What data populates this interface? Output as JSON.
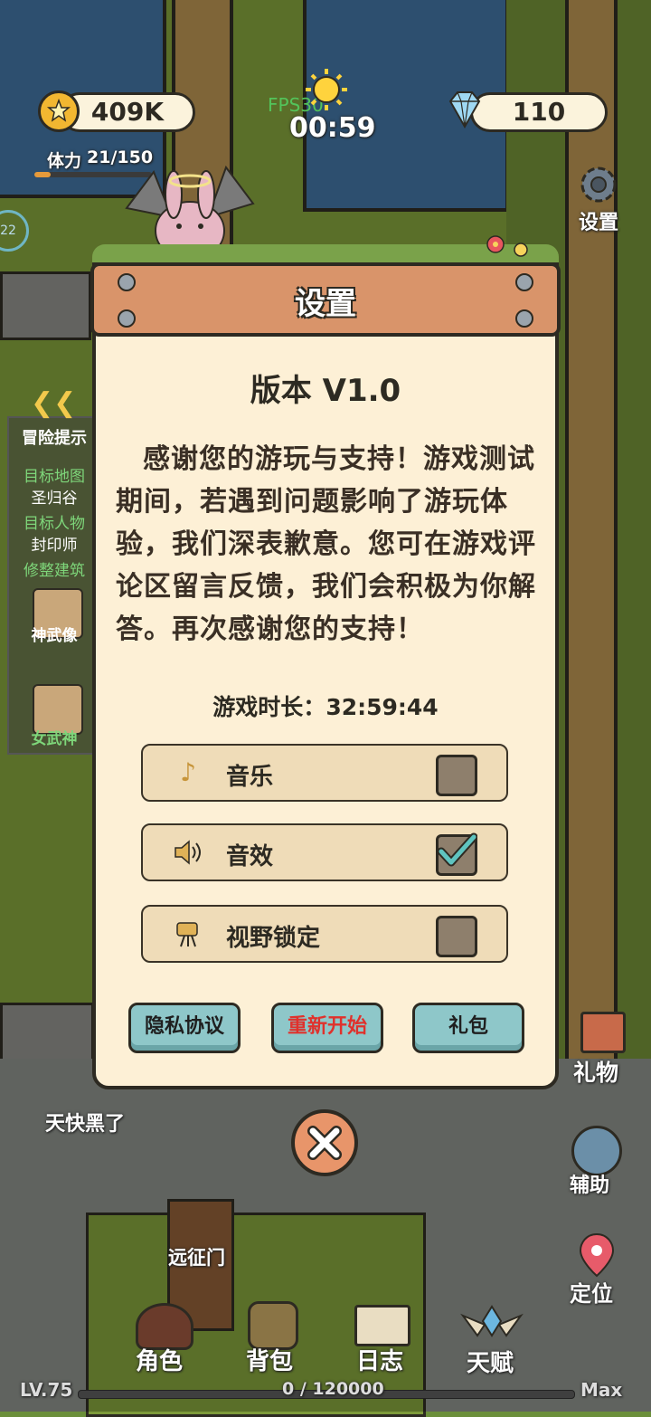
{
  "hud": {
    "coins": "409K",
    "gems": "110",
    "fps": "FPS30",
    "timer": "00:59",
    "stamina_label": "体力",
    "stamina_value": "21/150",
    "stamina_fraction": 0.14,
    "settings_label": "设置",
    "level_ring": "22"
  },
  "quest": {
    "header": "冒险提示",
    "target_map_label": "目标地图",
    "target_map_value": "圣归谷",
    "target_npc_label": "目标人物",
    "target_npc_value": "封印师",
    "task_label": "修整建筑",
    "statue1": "神武像",
    "statue2": "女武神"
  },
  "modal": {
    "title": "设置",
    "version": "版本 V1.0",
    "message": "感谢您的游玩与支持！游戏测试期间，若遇到问题影响了游玩体验，我们深表歉意。您可在游戏评论区留言反馈，我们会积极为你解答。再次感谢您的支持！",
    "playtime_label": "游戏时长：",
    "playtime_value": "32:59:44",
    "toggles": [
      {
        "label": "音乐",
        "icon": "music-note-icon",
        "checked": false
      },
      {
        "label": "音效",
        "icon": "speaker-icon",
        "checked": true
      },
      {
        "label": "视野锁定",
        "icon": "camera-icon",
        "checked": false
      }
    ],
    "buttons": {
      "privacy": "隐私协议",
      "restart": "重新开始",
      "gift_pack": "礼包"
    }
  },
  "world": {
    "night_notice": "天快黑了",
    "gate_label": "远征门"
  },
  "side_menu": {
    "gift": "礼物",
    "assist": "辅助",
    "locate": "定位"
  },
  "bottom_nav": {
    "character": "角色",
    "bag": "背包",
    "journal": "日志",
    "talent": "天赋"
  },
  "xp": {
    "level": "LV.75",
    "progress": "0 / 120000",
    "max": "Max",
    "fraction": 0
  },
  "colors": {
    "checkbox_checked": "#5fc4c0",
    "restart_text": "#e0312c",
    "accent_button": "#8ec7c9"
  }
}
